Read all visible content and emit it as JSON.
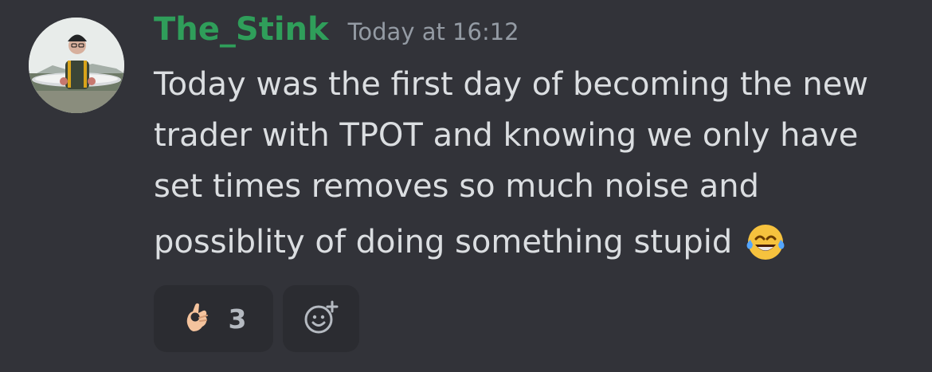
{
  "author": {
    "name": "The_Stink",
    "name_color": "#2f9e5a",
    "timestamp": "Today at 16:12",
    "avatar_icon": "fisherman-avatar"
  },
  "message": {
    "lines": [
      "Today was the first day of becoming the new",
      "trader with TPOT and knowing we only have",
      "set times removes so much noise and",
      "possiblity of doing something stupid"
    ],
    "emoji": "face-with-tears-of-joy-emoji"
  },
  "reactions": [
    {
      "emoji": "ok-hand-emoji",
      "count": "3"
    }
  ],
  "add_reaction_icon": "add-reaction-icon",
  "colors": {
    "background": "#323339",
    "text": "#dbdee1",
    "muted": "#949ba4",
    "reaction_bg": "#2b2c31"
  }
}
